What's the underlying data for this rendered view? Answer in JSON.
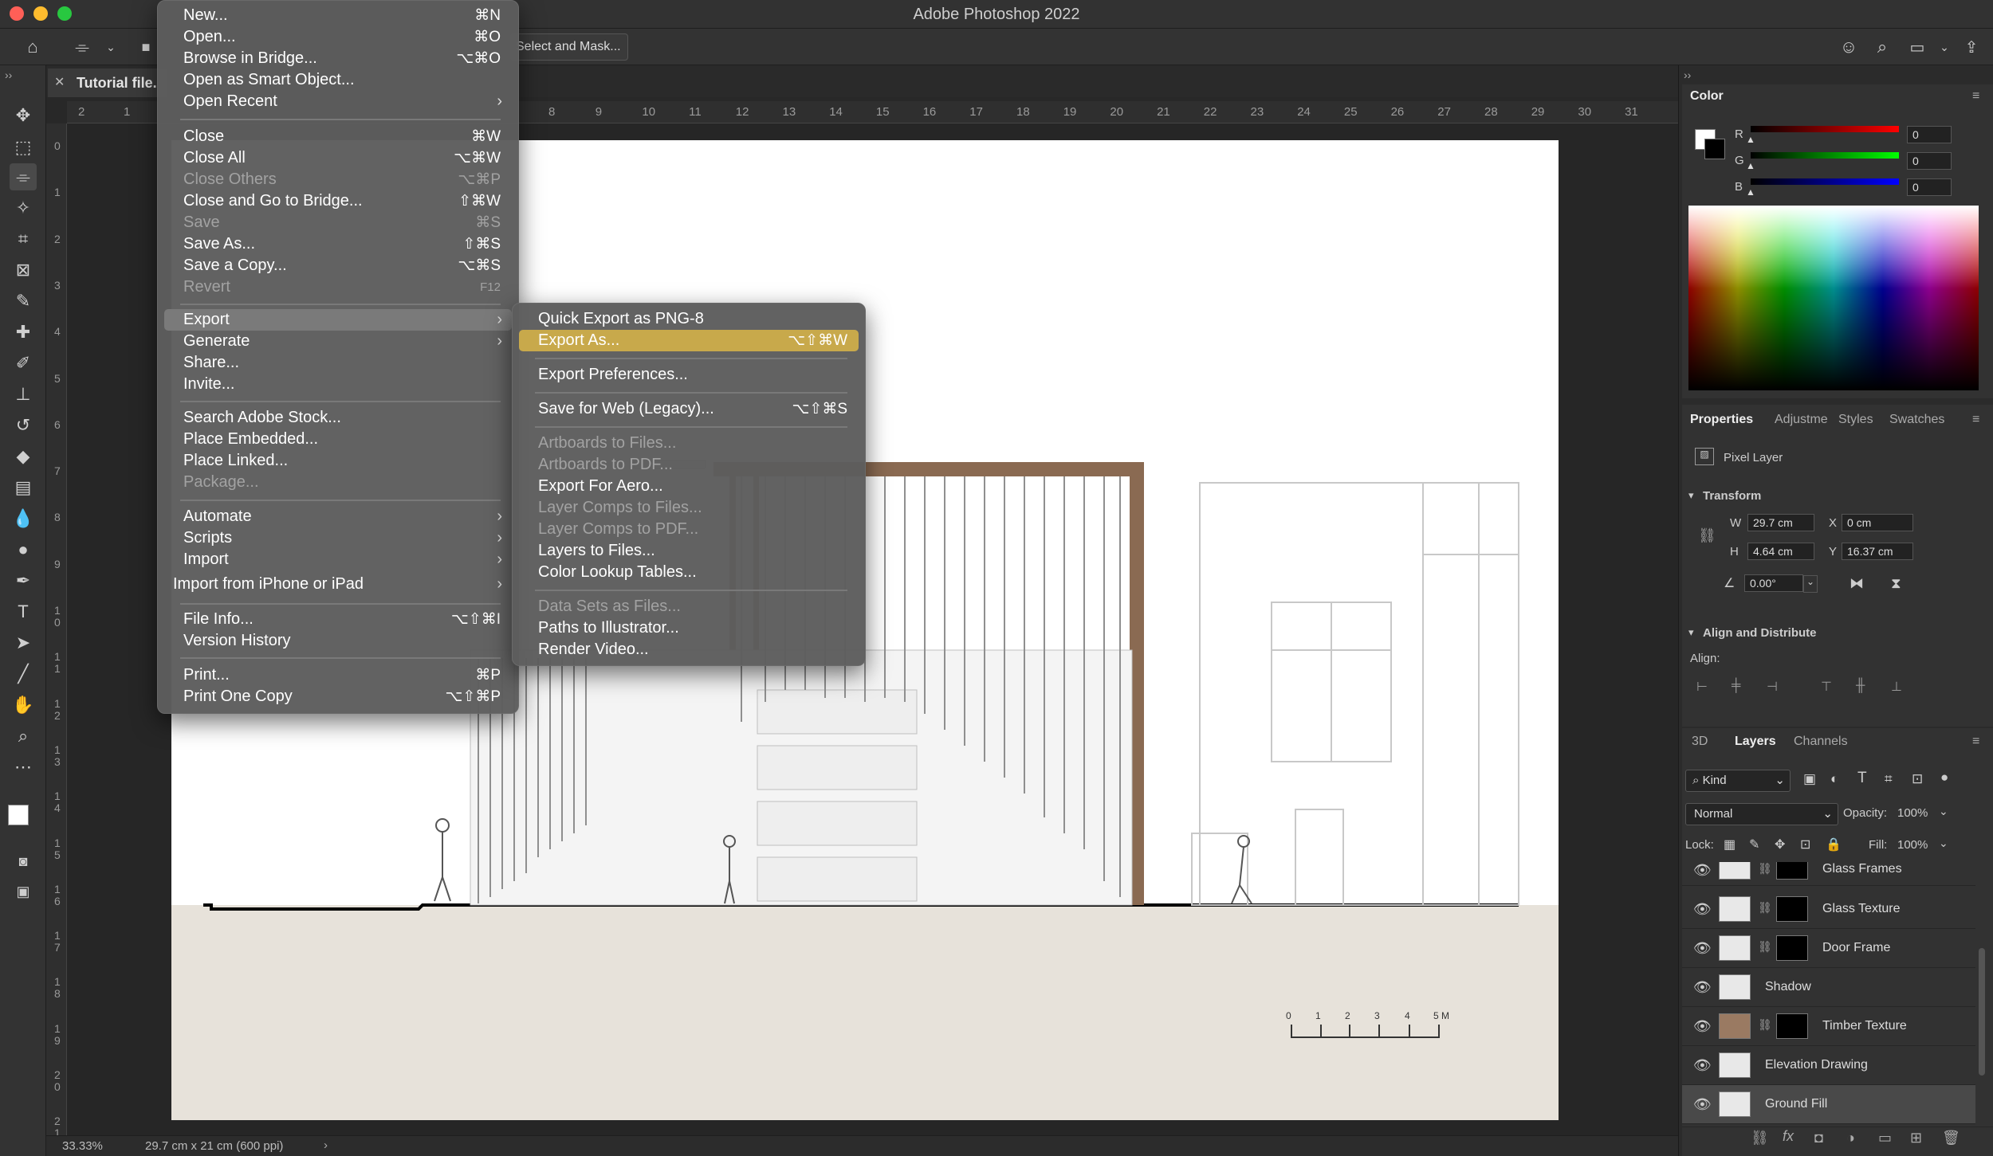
{
  "app": {
    "title": "Adobe Photoshop 2022"
  },
  "options_bar": {
    "select_and_mask": "Select and Mask..."
  },
  "document": {
    "tab_label": "Tutorial file.",
    "zoom": "33.33%",
    "doc_info": "29.7 cm x 21 cm (600 ppi)"
  },
  "ruler": {
    "h_ticks": [
      "2",
      "1",
      "8",
      "9",
      "10",
      "11",
      "12",
      "13",
      "14",
      "15",
      "16",
      "17",
      "18",
      "19",
      "20",
      "21",
      "22",
      "23",
      "24",
      "25",
      "26",
      "27",
      "28",
      "29",
      "30",
      "31"
    ],
    "v_ticks": [
      "0",
      "1",
      "2",
      "3",
      "4",
      "5",
      "6",
      "7",
      "8",
      "9",
      "10",
      "11",
      "12",
      "13",
      "14",
      "15",
      "16",
      "17",
      "18",
      "19",
      "20",
      "21"
    ]
  },
  "scale_bar": {
    "labels": [
      "0",
      "1",
      "2",
      "3",
      "4",
      "5 M"
    ]
  },
  "file_menu": {
    "items": [
      {
        "label": "New...",
        "shortcut": "⌘N"
      },
      {
        "label": "Open...",
        "shortcut": "⌘O"
      },
      {
        "label": "Browse in Bridge...",
        "shortcut": "⌥⌘O"
      },
      {
        "label": "Open as Smart Object...",
        "shortcut": ""
      },
      {
        "label": "Open Recent",
        "shortcut": "›"
      },
      {
        "label": "Close",
        "shortcut": "⌘W"
      },
      {
        "label": "Close All",
        "shortcut": "⌥⌘W"
      },
      {
        "label": "Close Others",
        "shortcut": "⌥⌘P"
      },
      {
        "label": "Close and Go to Bridge...",
        "shortcut": "⇧⌘W"
      },
      {
        "label": "Save",
        "shortcut": "⌘S"
      },
      {
        "label": "Save As...",
        "shortcut": "⇧⌘S"
      },
      {
        "label": "Save a Copy...",
        "shortcut": "⌥⌘S"
      },
      {
        "label": "Revert",
        "shortcut": "F12"
      },
      {
        "label": "Export",
        "shortcut": "›"
      },
      {
        "label": "Generate",
        "shortcut": "›"
      },
      {
        "label": "Share...",
        "shortcut": ""
      },
      {
        "label": "Invite...",
        "shortcut": ""
      },
      {
        "label": "Search Adobe Stock...",
        "shortcut": ""
      },
      {
        "label": "Place Embedded...",
        "shortcut": ""
      },
      {
        "label": "Place Linked...",
        "shortcut": ""
      },
      {
        "label": "Package...",
        "shortcut": ""
      },
      {
        "label": "Automate",
        "shortcut": "›"
      },
      {
        "label": "Scripts",
        "shortcut": "›"
      },
      {
        "label": "Import",
        "shortcut": "›"
      },
      {
        "label": "Import from iPhone or iPad",
        "shortcut": "›"
      },
      {
        "label": "File Info...",
        "shortcut": "⌥⇧⌘I"
      },
      {
        "label": "Version History",
        "shortcut": ""
      },
      {
        "label": "Print...",
        "shortcut": "⌘P"
      },
      {
        "label": "Print One Copy",
        "shortcut": "⌥⇧⌘P"
      }
    ]
  },
  "export_menu": {
    "items": [
      {
        "label": "Quick Export as PNG-8",
        "shortcut": ""
      },
      {
        "label": "Export As...",
        "shortcut": "⌥⇧⌘W"
      },
      {
        "label": "Export Preferences...",
        "shortcut": ""
      },
      {
        "label": "Save for Web (Legacy)...",
        "shortcut": "⌥⇧⌘S"
      },
      {
        "label": "Artboards to Files...",
        "shortcut": ""
      },
      {
        "label": "Artboards to PDF...",
        "shortcut": ""
      },
      {
        "label": "Export For Aero...",
        "shortcut": ""
      },
      {
        "label": "Layer Comps to Files...",
        "shortcut": ""
      },
      {
        "label": "Layer Comps to PDF...",
        "shortcut": ""
      },
      {
        "label": "Layers to Files...",
        "shortcut": ""
      },
      {
        "label": "Color Lookup Tables...",
        "shortcut": ""
      },
      {
        "label": "Data Sets as Files...",
        "shortcut": ""
      },
      {
        "label": "Paths to Illustrator...",
        "shortcut": ""
      },
      {
        "label": "Render Video...",
        "shortcut": ""
      }
    ]
  },
  "color_panel": {
    "title": "Color",
    "channels": [
      {
        "label": "R",
        "value": "0"
      },
      {
        "label": "G",
        "value": "0"
      },
      {
        "label": "B",
        "value": "0"
      }
    ],
    "colors": {
      "r": "#ff0000",
      "g": "#00ff00",
      "b": "#0000ff"
    }
  },
  "properties_panel": {
    "tabs": [
      "Properties",
      "Adjustme",
      "Styles",
      "Swatches"
    ],
    "layer_kind": "Pixel Layer",
    "transform_title": "Transform",
    "w_label": "W",
    "w": "29.7 cm",
    "x_label": "X",
    "x": "0 cm",
    "h_label": "H",
    "h": "4.64 cm",
    "y_label": "Y",
    "y": "16.37 cm",
    "angle": "0.00°",
    "align_title": "Align and Distribute",
    "align_label": "Align:"
  },
  "layers_panel": {
    "tabs": [
      "3D",
      "Layers",
      "Channels"
    ],
    "filter": "Kind",
    "blend_mode": "Normal",
    "opacity_label": "Opacity:",
    "opacity": "100%",
    "lock_label": "Lock:",
    "fill_label": "Fill:",
    "fill": "100%",
    "layers": [
      {
        "name": "Glass Frames",
        "mask": true
      },
      {
        "name": "Glass Texture",
        "mask": true
      },
      {
        "name": "Door Frame",
        "mask": true
      },
      {
        "name": "Shadow",
        "mask": false
      },
      {
        "name": "Timber Texture",
        "mask": true
      },
      {
        "name": "Elevation Drawing",
        "mask": false
      },
      {
        "name": "Ground Fill",
        "mask": false
      }
    ]
  }
}
